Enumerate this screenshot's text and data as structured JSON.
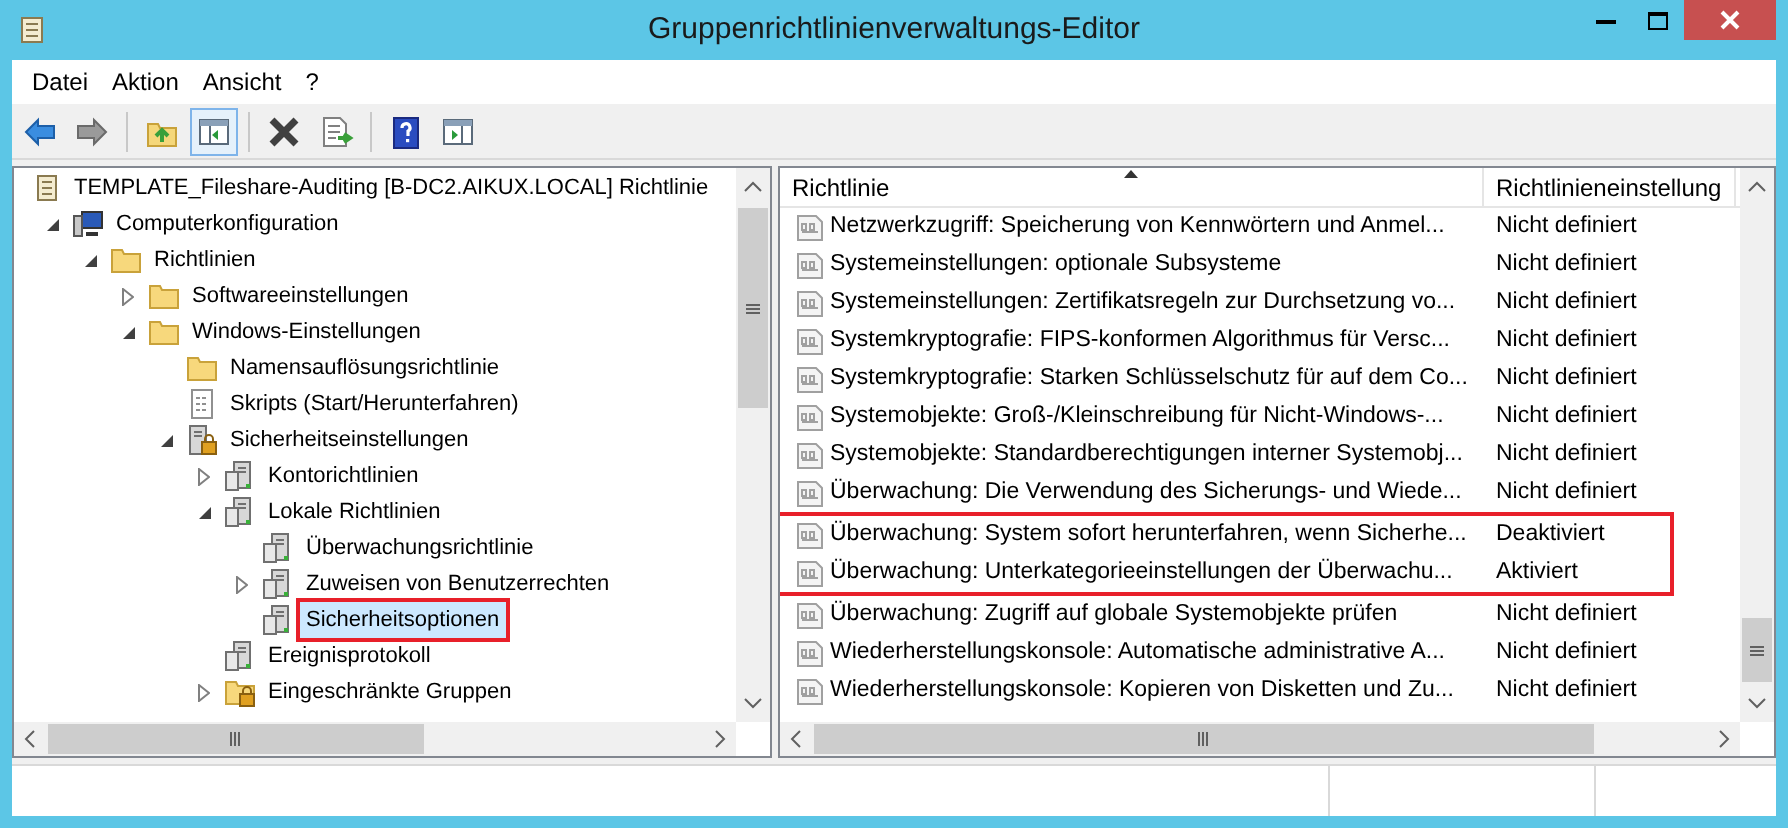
{
  "window": {
    "title": "Gruppenrichtlinienverwaltungs-Editor"
  },
  "menu": [
    "Datei",
    "Aktion",
    "Ansicht",
    "?"
  ],
  "toolbar": [
    {
      "kind": "back",
      "pressed": false
    },
    {
      "kind": "forward",
      "pressed": false
    },
    {
      "kind": "sep"
    },
    {
      "kind": "up",
      "pressed": false
    },
    {
      "kind": "tree",
      "pressed": true
    },
    {
      "kind": "sep"
    },
    {
      "kind": "delete",
      "pressed": false
    },
    {
      "kind": "export",
      "pressed": false
    },
    {
      "kind": "sep"
    },
    {
      "kind": "help",
      "pressed": false
    },
    {
      "kind": "pane",
      "pressed": false
    }
  ],
  "tree": [
    {
      "label": "TEMPLATE_Fileshare-Auditing [B-DC2.AIKUX.LOCAL] Richtlinie",
      "kind": "scroll",
      "selected": false,
      "children": [
        {
          "label": "Computerkonfiguration",
          "kind": "computer",
          "expanded": true,
          "selected": false,
          "children": [
            {
              "label": "Richtlinien",
              "kind": "folder",
              "expanded": true,
              "selected": false,
              "children": [
                {
                  "label": "Softwareeinstellungen",
                  "kind": "folder",
                  "expanded": false,
                  "selected": false
                },
                {
                  "label": "Windows-Einstellungen",
                  "kind": "folder",
                  "expanded": true,
                  "selected": false,
                  "children": [
                    {
                      "label": "Namensauflösungsrichtlinie",
                      "kind": "folder",
                      "selected": false
                    },
                    {
                      "label": "Skripts (Start/Herunterfahren)",
                      "kind": "script",
                      "selected": false
                    },
                    {
                      "label": "Sicherheitseinstellungen",
                      "kind": "security",
                      "expanded": true,
                      "selected": false,
                      "children": [
                        {
                          "label": "Kontorichtlinien",
                          "kind": "server",
                          "expanded": false,
                          "selected": false
                        },
                        {
                          "label": "Lokale Richtlinien",
                          "kind": "server",
                          "expanded": true,
                          "selected": false,
                          "children": [
                            {
                              "label": "Überwachungsrichtlinie",
                              "kind": "server",
                              "selected": false
                            },
                            {
                              "label": "Zuweisen von Benutzerrechten",
                              "kind": "server",
                              "expanded": false,
                              "selected": false
                            },
                            {
                              "label": "Sicherheitsoptionen",
                              "kind": "server",
                              "selected": true,
                              "highlighted": true
                            }
                          ]
                        },
                        {
                          "label": "Ereignisprotokoll",
                          "kind": "server",
                          "selected": false
                        },
                        {
                          "label": "Eingeschränkte Gruppen",
                          "kind": "folder-lock",
                          "expanded": false,
                          "selected": false
                        }
                      ]
                    }
                  ]
                }
              ]
            }
          ]
        }
      ]
    }
  ],
  "table": {
    "columns": [
      "Richtlinie",
      "Richtlinieneinstellung"
    ],
    "rows": [
      {
        "policy": "Netzwerkzugriff: Speicherung von Kennwörtern und Anmel...",
        "setting": "Nicht definiert",
        "highlighted": false
      },
      {
        "policy": "Systemeinstellungen: optionale Subsysteme",
        "setting": "Nicht definiert",
        "highlighted": false
      },
      {
        "policy": "Systemeinstellungen: Zertifikatsregeln zur Durchsetzung vo...",
        "setting": "Nicht definiert",
        "highlighted": false
      },
      {
        "policy": "Systemkryptografie: FIPS-konformen Algorithmus für Versc...",
        "setting": "Nicht definiert",
        "highlighted": false
      },
      {
        "policy": "Systemkryptografie: Starken Schlüsselschutz für auf dem Co...",
        "setting": "Nicht definiert",
        "highlighted": false
      },
      {
        "policy": "Systemobjekte: Groß-/Kleinschreibung für Nicht-Windows-...",
        "setting": "Nicht definiert",
        "highlighted": false
      },
      {
        "policy": "Systemobjekte: Standardberechtigungen interner Systemobj...",
        "setting": "Nicht definiert",
        "highlighted": false
      },
      {
        "policy": "Überwachung: Die Verwendung des Sicherungs- und Wiede...",
        "setting": "Nicht definiert",
        "highlighted": false
      },
      {
        "policy": "Überwachung: System sofort herunterfahren, wenn Sicherhe...",
        "setting": "Deaktiviert",
        "highlighted": true
      },
      {
        "policy": "Überwachung: Unterkategorieeinstellungen der Überwachu...",
        "setting": "Aktiviert",
        "highlighted": true
      },
      {
        "policy": "Überwachung: Zugriff auf globale Systemobjekte prüfen",
        "setting": "Nicht definiert",
        "highlighted": false
      },
      {
        "policy": "Wiederherstellungskonsole: Automatische administrative A...",
        "setting": "Nicht definiert",
        "highlighted": false
      },
      {
        "policy": "Wiederherstellungskonsole: Kopieren von Disketten und Zu...",
        "setting": "Nicht definiert",
        "highlighted": false
      }
    ]
  }
}
